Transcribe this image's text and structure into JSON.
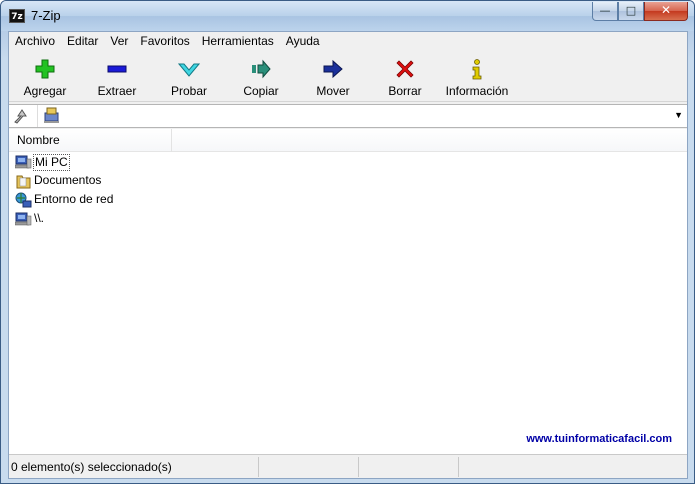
{
  "window": {
    "title": "7-Zip",
    "app_icon_text": "7z",
    "minimize_glyph": "—",
    "maximize_glyph": "□",
    "close_glyph": "✕"
  },
  "menu": [
    "Archivo",
    "Editar",
    "Ver",
    "Favoritos",
    "Herramientas",
    "Ayuda"
  ],
  "toolbar": [
    {
      "label": "Agregar",
      "icon": "plus-icon",
      "color": "#1db11d"
    },
    {
      "label": "Extraer",
      "icon": "minus-icon",
      "color": "#1a1ad8"
    },
    {
      "label": "Probar",
      "icon": "check-chevron-icon",
      "color": "#2bc4d4"
    },
    {
      "label": "Copiar",
      "icon": "double-arrow-right-icon",
      "color": "#2a8f7a"
    },
    {
      "label": "Mover",
      "icon": "arrow-right-icon",
      "color": "#1a2f9a"
    },
    {
      "label": "Borrar",
      "icon": "x-icon",
      "color": "#e01010"
    },
    {
      "label": "Información",
      "icon": "info-icon",
      "color": "#d8c400"
    }
  ],
  "address": {
    "value": "",
    "dropdown_glyph": "▼"
  },
  "list": {
    "columns": [
      "Nombre"
    ],
    "items": [
      {
        "name": "Mi PC",
        "icon": "computer-icon"
      },
      {
        "name": "Documentos",
        "icon": "folder-icon"
      },
      {
        "name": "Entorno de red",
        "icon": "network-icon"
      },
      {
        "name": "\\\\.",
        "icon": "computer-icon"
      }
    ]
  },
  "watermark": "www.tuinformaticafacil.com",
  "status": {
    "selection": "0 elemento(s) seleccionado(s)",
    "cell2": "",
    "cell3": ""
  }
}
